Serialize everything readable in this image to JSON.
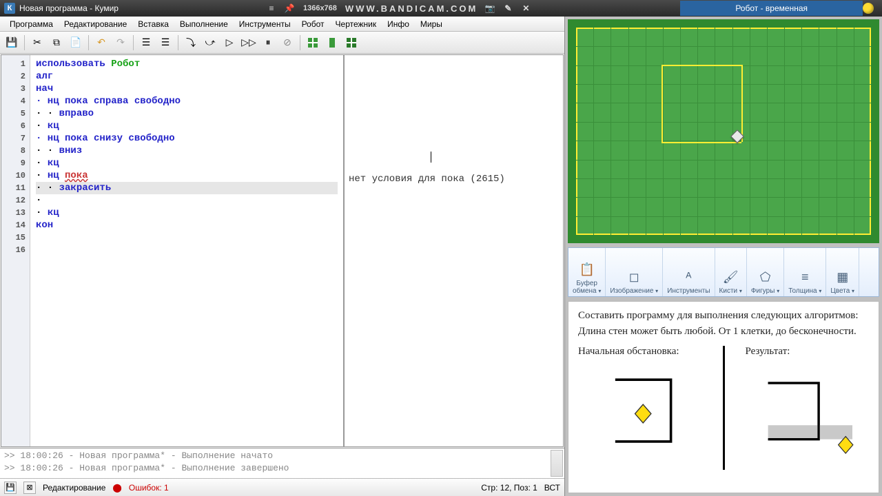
{
  "topbar": {
    "app_icon_letter": "К",
    "title": "Новая программа - Кумир",
    "menu_icon": "≡",
    "pin_icon": "📌",
    "resolution": "1366x768",
    "bandicam": "WWW.BANDICAM.COM",
    "cam_icon": "📷",
    "edit_icon": "✎",
    "close_icon": "✕",
    "robot_title": "Робот - временная"
  },
  "menubar": [
    "Программа",
    "Редактирование",
    "Вставка",
    "Выполнение",
    "Инструменты",
    "Робот",
    "Чертежник",
    "Инфо",
    "Миры"
  ],
  "code": {
    "lines": [
      {
        "n": 1,
        "segs": [
          {
            "t": "использовать ",
            "c": "kw-blue"
          },
          {
            "t": "Робот",
            "c": "kw-green"
          }
        ]
      },
      {
        "n": 2,
        "segs": [
          {
            "t": "алг",
            "c": "kw-blue"
          }
        ]
      },
      {
        "n": 3,
        "segs": [
          {
            "t": "нач",
            "c": "kw-blue"
          }
        ]
      },
      {
        "n": 4,
        "segs": [
          {
            "t": "· нц пока ",
            "c": "kw-blue"
          },
          {
            "t": "справа свободно",
            "c": "kw-blue"
          }
        ]
      },
      {
        "n": 5,
        "segs": [
          {
            "t": "· · ",
            "c": ""
          },
          {
            "t": "вправо",
            "c": "kw-blue"
          }
        ]
      },
      {
        "n": 6,
        "segs": [
          {
            "t": "· ",
            "c": ""
          },
          {
            "t": "кц",
            "c": "kw-blue"
          }
        ]
      },
      {
        "n": 7,
        "segs": [
          {
            "t": "· нц пока ",
            "c": "kw-blue"
          },
          {
            "t": "снизу свободно",
            "c": "kw-blue"
          }
        ]
      },
      {
        "n": 8,
        "segs": [
          {
            "t": "· · ",
            "c": ""
          },
          {
            "t": "вниз",
            "c": "kw-blue"
          }
        ]
      },
      {
        "n": 9,
        "segs": [
          {
            "t": "· ",
            "c": ""
          },
          {
            "t": "кц",
            "c": "kw-blue"
          }
        ]
      },
      {
        "n": 10,
        "segs": [
          {
            "t": "· ",
            "c": ""
          },
          {
            "t": "нц ",
            "c": "kw-blue"
          },
          {
            "t": "пока",
            "c": "kw-err"
          }
        ]
      },
      {
        "n": 11,
        "segs": [
          {
            "t": "· · ",
            "c": ""
          },
          {
            "t": "закрасить",
            "c": "kw-blue"
          }
        ],
        "sel": true
      },
      {
        "n": 12,
        "segs": [
          {
            "t": "· ",
            "c": ""
          }
        ]
      },
      {
        "n": 13,
        "segs": [
          {
            "t": "· ",
            "c": ""
          },
          {
            "t": "кц",
            "c": "kw-blue"
          }
        ]
      },
      {
        "n": 14,
        "segs": [
          {
            "t": "кон",
            "c": "kw-blue"
          }
        ]
      },
      {
        "n": 15,
        "segs": [
          {
            "t": " ",
            "c": ""
          }
        ]
      },
      {
        "n": 16,
        "segs": [
          {
            "t": " ",
            "c": ""
          }
        ]
      }
    ]
  },
  "msg": {
    "text": "нет условия для пока  (2615)"
  },
  "console": {
    "l1": ">> 18:00:26 - Новая программа* - Выполнение начато",
    "l2": ">> 18:00:26 - Новая программа* - Выполнение завершено"
  },
  "status": {
    "mode": "Редактирование",
    "errors": "Ошибок: 1",
    "pos": "Стр: 12, Поз: 1",
    "ins": "ВСТ"
  },
  "paint_groups": [
    {
      "icon": "📋",
      "label": "Буфер\nобмена",
      "arrow": true
    },
    {
      "icon": "◻",
      "label": "Изображение",
      "arrow": true
    },
    {
      "icon": "ᴬ",
      "label": "Инструменты",
      "arrow": false
    },
    {
      "icon": "🖌",
      "label": "Кисти",
      "arrow": true
    },
    {
      "icon": "⬠",
      "label": "Фигуры",
      "arrow": true
    },
    {
      "icon": "≡",
      "label": "Толщина",
      "arrow": true
    },
    {
      "icon": "▦",
      "label": "Цвета",
      "arrow": true
    }
  ],
  "task": {
    "p1": "Составить программу для выполнения следующих алгоритмов:",
    "p2": "Длина стен может быть любой. От 1 клетки, до бесконечности.",
    "fig1_title": "Начальная обстановка:",
    "fig2_title": "Результат:"
  }
}
